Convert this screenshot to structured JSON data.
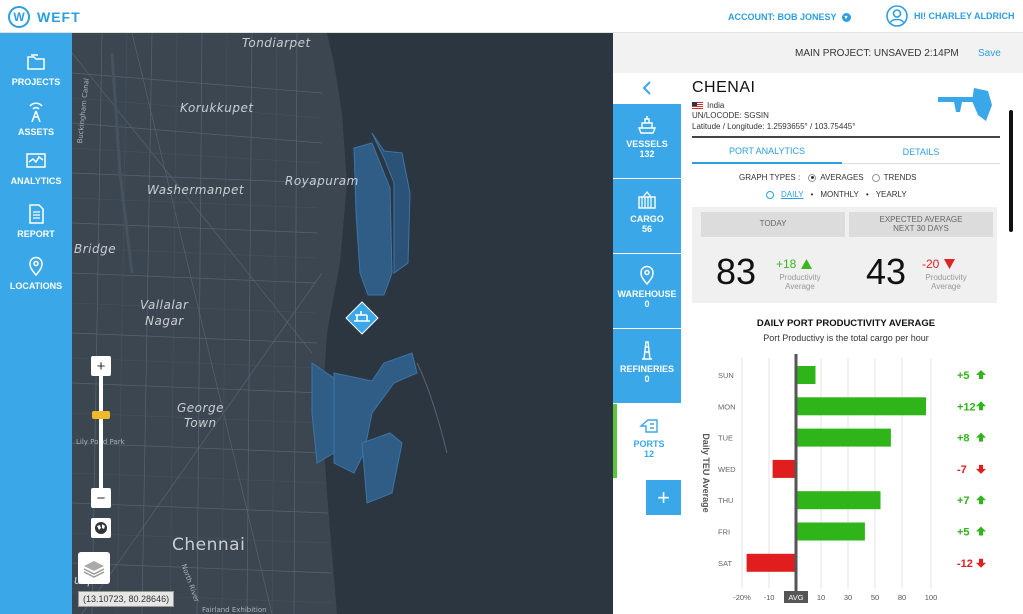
{
  "app": {
    "logo_letter": "W",
    "name": "WEFT"
  },
  "header": {
    "account_label": "ACCOUNT: BOB JONESY",
    "user_greeting": "HI! CHARLEY ALDRICH"
  },
  "leftnav": {
    "items": [
      {
        "label": "PROJECTS",
        "icon": "folder-icon"
      },
      {
        "label": "ASSETS",
        "icon": "antenna-icon"
      },
      {
        "label": "ANALYTICS",
        "icon": "analytics-icon"
      },
      {
        "label": "REPORT",
        "icon": "document-icon"
      },
      {
        "label": "LOCATIONS",
        "icon": "location-pin-icon"
      }
    ]
  },
  "map": {
    "labels": {
      "tondiarpet": "Tondiarpet",
      "korukkupet": "Korukkupet",
      "washermanpet": "Washermanpet",
      "royapuram": "Royapuram",
      "bridge": "Bridge",
      "vallalar": "Vallalar",
      "nagar": "Nagar",
      "george": "George",
      "town": "Town",
      "chennai": "Chennai",
      "buckingham": "Buckingham Canal",
      "lilypond": "Lily Pond Park",
      "bottom": "urpet",
      "north_river": "North River",
      "exhibition": "Fairland Exhibition"
    },
    "coordinates": "(13.10723, 80.28646)"
  },
  "project": {
    "status": "MAIN PROJECT: UNSAVED 2:14PM",
    "save_label": "Save"
  },
  "asset_tabs": [
    {
      "label": "VESSELS",
      "count": "132",
      "icon": "ship-icon"
    },
    {
      "label": "CARGO",
      "count": "56",
      "icon": "cargo-icon"
    },
    {
      "label": "WAREHOUSE",
      "count": "0",
      "icon": "location-pin-icon"
    },
    {
      "label": "REFINERIES",
      "count": "0",
      "icon": "refinery-icon"
    },
    {
      "label": "PORTS",
      "count": "12",
      "icon": "port-icon"
    }
  ],
  "port": {
    "name": "CHENAI",
    "country": "India",
    "code": "UN/LOCODE: SGSIN",
    "latlon": "Latitude / Longitude: 1.2593655° / 103.75445°"
  },
  "detail_tabs": {
    "analytics": "PORT ANALYTICS",
    "details": "DETAILS"
  },
  "graph_options": {
    "label": "GRAPH TYPES :",
    "averages": "AVERAGES",
    "trends": "TRENDS",
    "selected_type": "AVERAGES",
    "daily": "DAILY",
    "monthly": "MONTHLY",
    "yearly": "YEARLY",
    "selected_period": "DAILY"
  },
  "stats": {
    "today_label": "TODAY",
    "expected_label_1": "EXPECTED AVERAGE",
    "expected_label_2": "NEXT 30 DAYS",
    "today_value": "83",
    "today_delta": "+18",
    "expected_value": "43",
    "expected_delta": "-20",
    "delta_label_1": "Productivity",
    "delta_label_2": "Average",
    "positive_color": "#3cb521",
    "negative_color": "#e02424"
  },
  "chart_data": {
    "type": "bar",
    "title": "DAILY PORT PRODUCTIVITY AVERAGE",
    "subtitle": "Port Productivy is the total cargo per hour",
    "ylabel": "Daily TEU Average",
    "categories": [
      "SUN",
      "MON",
      "TUE",
      "WED",
      "THU",
      "FRI",
      "SAT"
    ],
    "values": [
      15,
      100,
      73,
      -18,
      65,
      53,
      -38
    ],
    "deltas": [
      "+5",
      "+12",
      "+8",
      "-7",
      "+7",
      "+5",
      "-12"
    ],
    "x_ticks": [
      "-20%",
      "-10",
      "AVG",
      "10",
      "30",
      "50",
      "80",
      "100"
    ],
    "positive_color": "#2fb51a",
    "negative_color": "#e01e1e"
  }
}
